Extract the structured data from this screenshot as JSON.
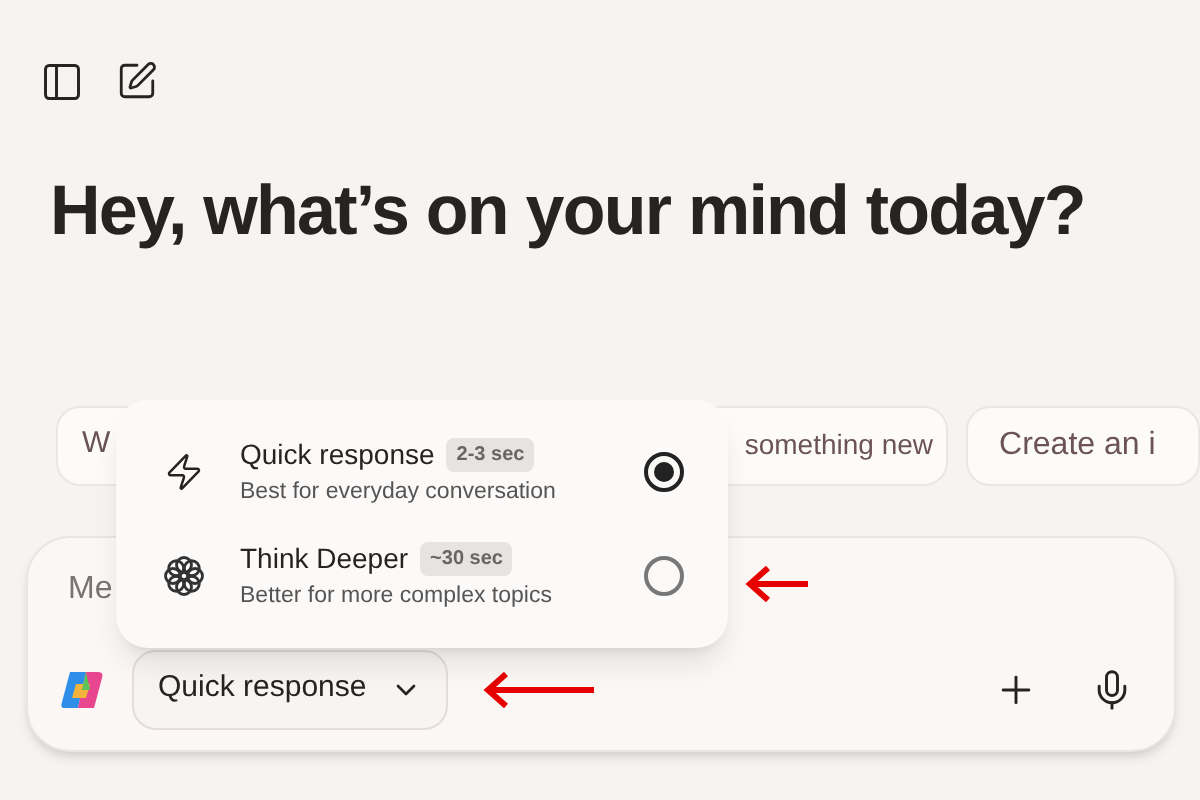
{
  "heading": "Hey, what’s on your mind today?",
  "suggestions": [
    "W",
    "something new",
    "Create an i"
  ],
  "composer": {
    "placeholder": "Me",
    "mode_button": "Quick response"
  },
  "mode_menu": {
    "items": [
      {
        "kind": "bolt",
        "title": "Quick response",
        "badge": "2-3 sec",
        "description": "Best for everyday conversation",
        "selected": true
      },
      {
        "kind": "flower",
        "title": "Think Deeper",
        "badge": "~30 sec",
        "description": "Better for more complex topics",
        "selected": false
      }
    ]
  }
}
